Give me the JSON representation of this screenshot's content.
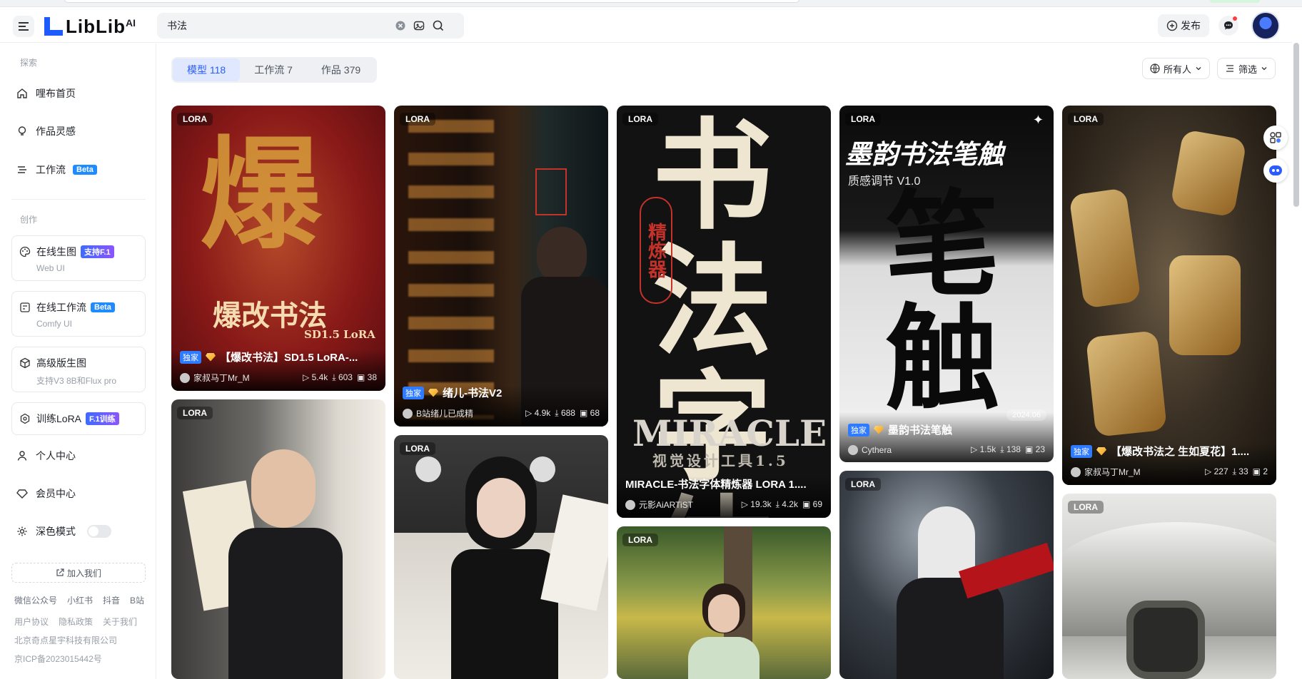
{
  "header": {
    "logo_text": "LibLib",
    "logo_suffix": "AI",
    "search_value": "书法",
    "publish_label": "发布"
  },
  "sidebar": {
    "explore_title": "探索",
    "nav_home": "哩布首页",
    "nav_inspiration": "作品灵感",
    "nav_workflow": "工作流",
    "nav_workflow_badge": "Beta",
    "create_title": "创作",
    "online_gen": "在线生图",
    "online_gen_badge": "支持F.1",
    "online_gen_sub": "Web UI",
    "online_flow": "在线工作流",
    "online_flow_badge": "Beta",
    "online_flow_sub": "Comfy UI",
    "advanced_gen": "高级版生图",
    "advanced_gen_sub": "支持V3 8B和Flux pro",
    "train_lora": "训练LoRA",
    "train_lora_badge": "F.1训练",
    "personal": "个人中心",
    "member": "会员中心",
    "dark_mode": "深色模式",
    "join_us": "加入我们",
    "social": [
      "微信公众号",
      "小红书",
      "抖音",
      "B站"
    ],
    "legal": [
      "用户协议",
      "隐私政策",
      "关于我们"
    ],
    "company": "北京奇点星宇科技有限公司",
    "icp": "京ICP备2023015442号"
  },
  "tabs": [
    {
      "label": "模型 118",
      "active": true
    },
    {
      "label": "工作流 7",
      "active": false
    },
    {
      "label": "作品 379",
      "active": false
    }
  ],
  "filters": {
    "owner": "所有人",
    "filter": "筛选"
  },
  "cards": {
    "c1": {
      "tag": "LORA",
      "title": "【爆改书法】SD1.5 LoRA-...",
      "exclusive": "独家",
      "author": "家叔马丁Mr_M",
      "runs": "5.4k",
      "downloads": "603",
      "images": "38",
      "art_title": "爆改书法",
      "art_sub": "SD1.5 LoRA"
    },
    "c2": {
      "tag": "LORA",
      "title": "绪儿-书法V2",
      "exclusive": "独家",
      "author": "B站绪儿已成精",
      "runs": "4.9k",
      "downloads": "688",
      "images": "68"
    },
    "c3": {
      "tag": "LORA",
      "title": "MIRACLE-书法字体精炼器 LORA 1....",
      "author": "元影AiARTiST",
      "runs": "19.3k",
      "downloads": "4.2k",
      "images": "69",
      "art_main": "书法字体",
      "art_miracle": "MIRACLE",
      "art_sub": "视觉设计工具1.5",
      "art_seal": "精炼器"
    },
    "c4": {
      "tag": "LORA",
      "title": "墨韵书法笔触",
      "exclusive": "独家",
      "date": "2024.06",
      "author": "Cythera",
      "runs": "1.5k",
      "downloads": "138",
      "images": "23",
      "art_title": "墨韵书法笔触",
      "art_sub": "质感调节 V1.0",
      "art_big": "笔触"
    },
    "c5": {
      "tag": "LORA",
      "title": "【爆改书法之 生如夏花】1....",
      "exclusive": "独家",
      "author": "家叔马丁Mr_M",
      "runs": "227",
      "downloads": "33",
      "images": "2"
    },
    "c6": {
      "tag": "LORA"
    },
    "c7": {
      "tag": "LORA"
    },
    "c8": {
      "tag": "LORA"
    },
    "c9": {
      "tag": "LORA"
    },
    "c10": {
      "tag": "LORA"
    }
  },
  "colors": {
    "brand": "#1e5bff",
    "tab_active_bg": "#dfe8ff",
    "tab_active_text": "#2b5cff",
    "badge_blue": "#1e8bff"
  }
}
